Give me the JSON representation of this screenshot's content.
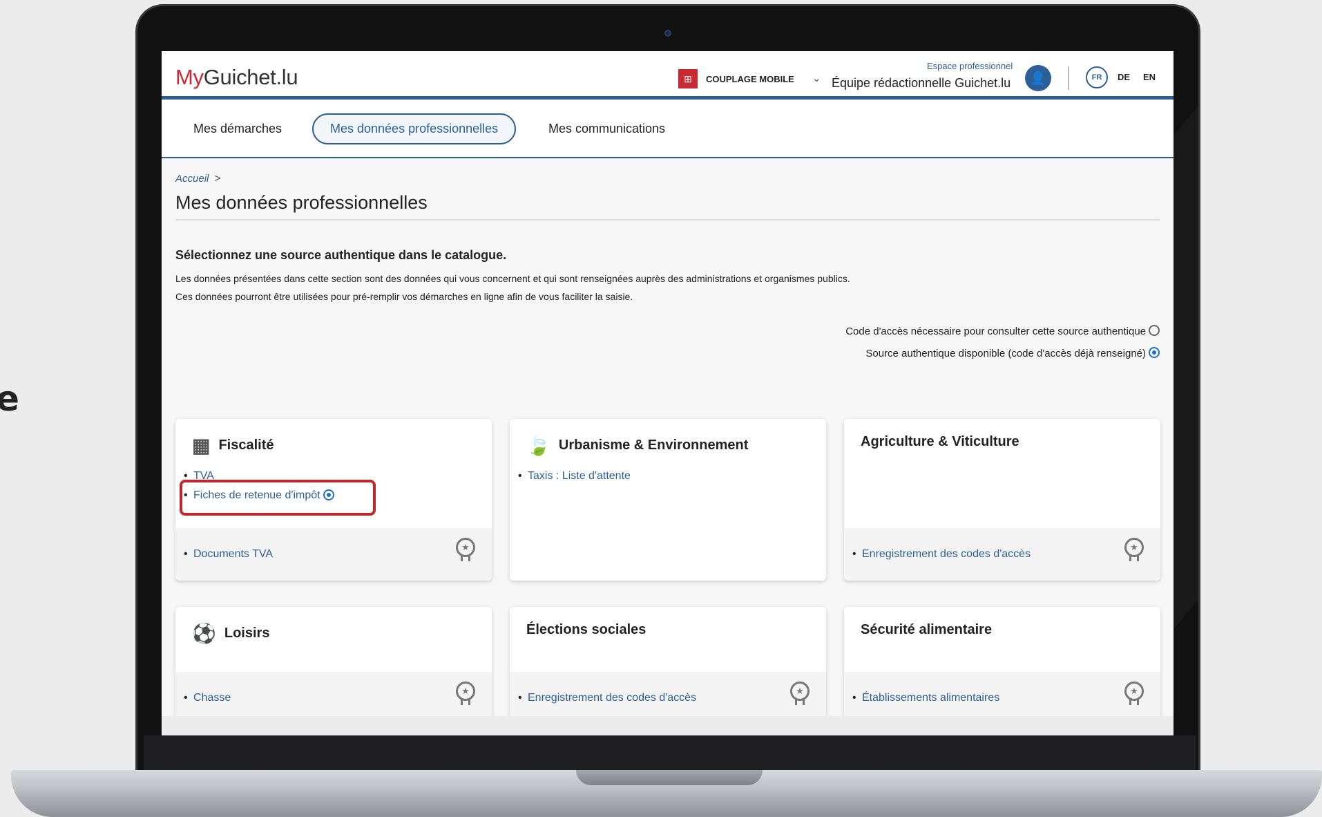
{
  "header": {
    "logo_my": "My",
    "logo_rest": "Guichet.lu",
    "coupling_label": "COUPLAGE MOBILE",
    "space_label": "Espace professionnel",
    "user_name": "Équipe rédactionnelle Guichet.lu",
    "languages": [
      "FR",
      "DE",
      "EN"
    ]
  },
  "nav": {
    "tabs": [
      "Mes démarches",
      "Mes données professionnelles",
      "Mes communications"
    ],
    "active": "Mes données professionnelles"
  },
  "breadcrumb": {
    "home": "Accueil",
    "separator": ">"
  },
  "page": {
    "title": "Mes données professionnelles",
    "intro_heading": "Sélectionnez une source authentique dans le catalogue.",
    "intro_lines": [
      "Les données présentées dans cette section sont des données qui vous concernent et qui sont renseignées auprès des administrations et organismes publics.",
      "Ces données pourront être utilisées pour pré-remplir vos démarches en ligne afin de vous faciliter la saisie."
    ],
    "legend": [
      "Code d'accès nécessaire pour consulter cette source authentique",
      "Source authentique disponible (code d'accès déjà renseigné)"
    ]
  },
  "cards": [
    {
      "title": "Fiscalité",
      "icon": "calculator-icon",
      "links": [
        "TVA",
        "Fiches de retenue d'impôt"
      ],
      "footer_link": "Documents TVA"
    },
    {
      "title": "Urbanisme & Environnement",
      "icon": "leaf-icon",
      "links": [
        "Taxis : Liste d'attente"
      ],
      "footer_link": ""
    },
    {
      "title": "Agriculture & Viticulture",
      "icon": "",
      "links": [],
      "footer_link": "Enregistrement des codes d'accès"
    },
    {
      "title": "Loisirs",
      "icon": "soccer-ball-icon",
      "links": [],
      "footer_link": "Chasse"
    },
    {
      "title": "Élections sociales",
      "icon": "",
      "links": [],
      "footer_link": "Enregistrement des codes d'accès"
    },
    {
      "title": "Sécurité alimentaire",
      "icon": "",
      "links": [],
      "footer_link": "Établissements alimentaires"
    }
  ],
  "colors": {
    "brand_blue": "#2d5f97",
    "brand_red": "#c92a35",
    "highlight": "#c0272d"
  },
  "edge_glyph": "e"
}
